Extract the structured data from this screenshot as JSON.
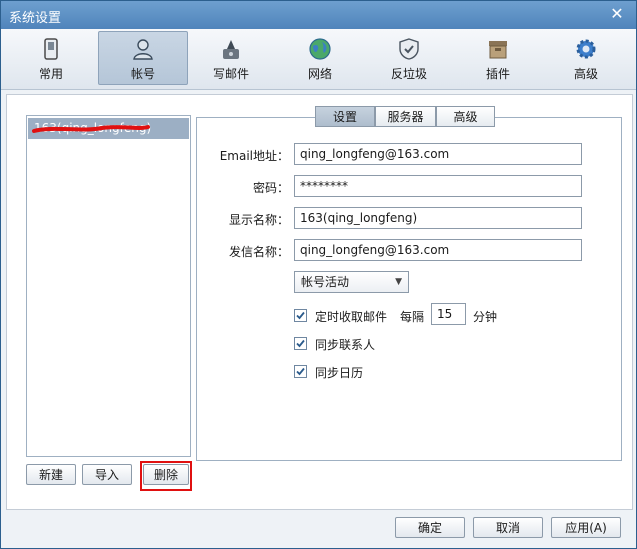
{
  "window": {
    "title": "系统设置"
  },
  "toolbar": {
    "items": [
      {
        "label": "常用",
        "icon": "phone-icon"
      },
      {
        "label": "帐号",
        "icon": "user-icon"
      },
      {
        "label": "写邮件",
        "icon": "compose-icon"
      },
      {
        "label": "网络",
        "icon": "globe-icon"
      },
      {
        "label": "反垃圾",
        "icon": "shield-icon"
      },
      {
        "label": "插件",
        "icon": "plugin-box-icon"
      },
      {
        "label": "高级",
        "icon": "gear-icon"
      }
    ],
    "active": "帐号"
  },
  "accounts": {
    "items": [
      {
        "label": "163(qing_longfeng)",
        "redacted": true
      }
    ],
    "new_label": "新建",
    "import_label": "导入",
    "delete_label": "删除"
  },
  "tabs": {
    "items": [
      "设置",
      "服务器",
      "高级"
    ],
    "active": "设置"
  },
  "form": {
    "email_label": "Email地址：",
    "email_value": "qing_longfeng@163.com",
    "password_label": "密码：",
    "password_value": "********",
    "display_label": "显示名称：",
    "display_value": "163(qing_longfeng)",
    "sender_label": "发信名称：",
    "sender_value": "qing_longfeng@163.com",
    "account_status": "帐号活动",
    "auto_receive_label": "定时收取邮件",
    "interval_prefix": "每隔",
    "interval_value": "15",
    "interval_unit": "分钟",
    "sync_contacts_label": "同步联系人",
    "sync_calendar_label": "同步日历"
  },
  "footer": {
    "ok_label": "确定",
    "cancel_label": "取消",
    "apply_label": "应用(A)"
  },
  "colors": {
    "title_bar": "#4f84bb",
    "selection": "#9cafc4",
    "highlight_box": "#e01010"
  }
}
